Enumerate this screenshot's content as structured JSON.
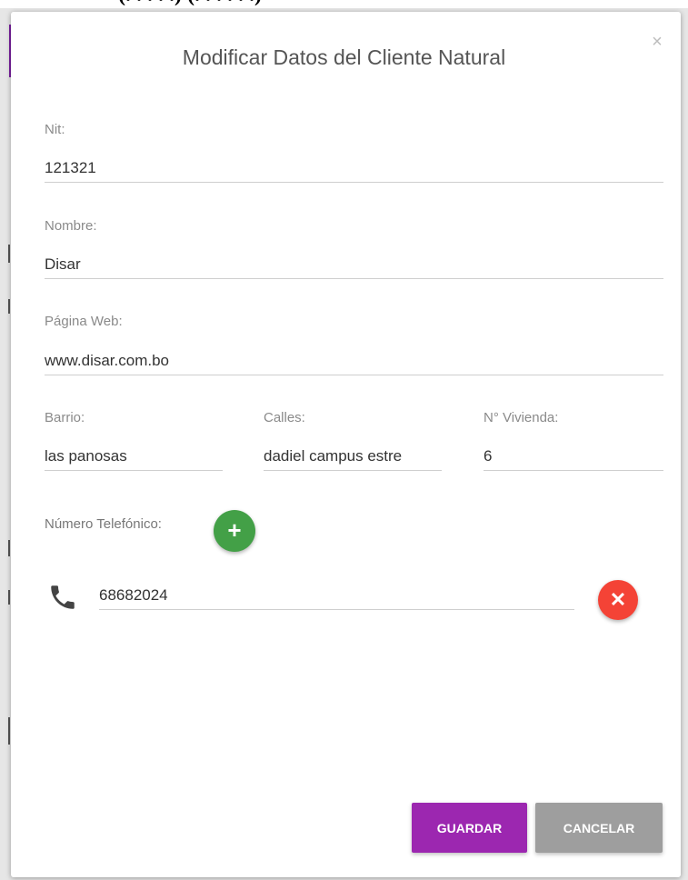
{
  "top_strip": {
    "text": "(. . . . .)                            (. . . . . .)"
  },
  "dialog": {
    "title": "Modificar Datos del Cliente Natural",
    "close_glyph": "×"
  },
  "form": {
    "nit": {
      "label": "Nit:",
      "value": "121321"
    },
    "nombre": {
      "label": "Nombre:",
      "value": "Disar"
    },
    "pagina_web": {
      "label": "Página Web:",
      "value": "www.disar.com.bo"
    },
    "barrio": {
      "label": "Barrio:",
      "value": "las panosas"
    },
    "calles": {
      "label": "Calles:",
      "value": "dadiel campus estre"
    },
    "vivienda": {
      "label": "N° Vivienda:",
      "value": "6"
    },
    "telefono": {
      "label": "Número Telefónico:",
      "add_glyph": "+",
      "phones": [
        {
          "value": "68682024",
          "remove_glyph": "✕"
        }
      ]
    }
  },
  "actions": {
    "save_label": "GUARDAR",
    "cancel_label": "CANCELAR"
  },
  "colors": {
    "save": "#9c27b0",
    "cancel": "#9e9e9e",
    "add": "#43a047",
    "remove": "#f44336",
    "accent": "#7b1fa2"
  },
  "icons": {
    "close": "close-icon",
    "add": "plus-icon",
    "phone": "phone-icon",
    "remove": "x-icon"
  }
}
